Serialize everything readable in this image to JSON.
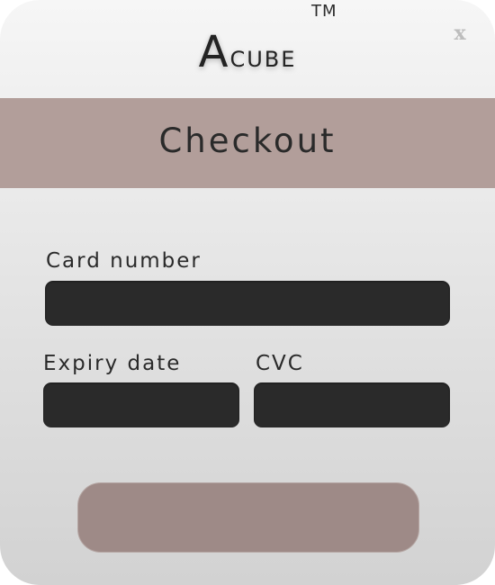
{
  "header": {
    "brand_first": "A",
    "brand_rest": "cube",
    "trademark": "TM",
    "close_label": "x"
  },
  "banner": {
    "title": "Checkout"
  },
  "form": {
    "card_number_label": "Card number",
    "card_number_value": "",
    "expiry_label": "Expiry date",
    "expiry_value": "",
    "cvc_label": "CVC",
    "cvc_value": "",
    "submit_label": ""
  },
  "colors": {
    "banner": "#b29e9a",
    "field": "#2a2a2a",
    "submit": "#9e8a87",
    "background_top": "#f6f6f6",
    "background_bottom": "#d2d2d2"
  }
}
